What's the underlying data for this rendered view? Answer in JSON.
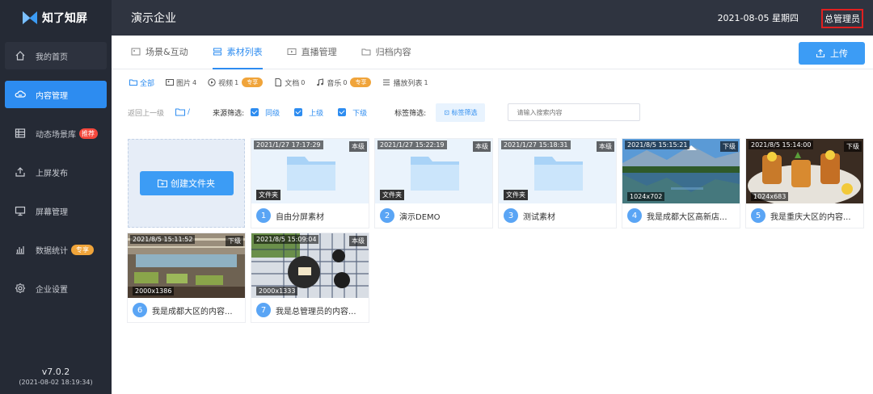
{
  "app": {
    "name": "知了知屏",
    "version": "v7.0.2",
    "build_date": "(2021-08-02 18:19:34)"
  },
  "topbar": {
    "company": "演示企业",
    "datetime": "2021-08-05 星期四",
    "role": "总管理员"
  },
  "sidebar": {
    "items": [
      {
        "label": "我的首页",
        "icon": "home-icon"
      },
      {
        "label": "内容管理",
        "icon": "cloud-icon"
      },
      {
        "label": "动态场景库",
        "icon": "grid-table-icon",
        "badge": "推荐"
      },
      {
        "label": "上屏发布",
        "icon": "publish-icon"
      },
      {
        "label": "屏幕管理",
        "icon": "monitor-icon"
      },
      {
        "label": "数据统计",
        "icon": "stats-icon",
        "badge": "专享"
      },
      {
        "label": "企业设置",
        "icon": "settings-icon"
      }
    ]
  },
  "tabs": [
    {
      "label": "场景&互动",
      "icon": "scene-icon"
    },
    {
      "label": "素材列表",
      "icon": "stack-icon"
    },
    {
      "label": "直播管理",
      "icon": "live-icon"
    },
    {
      "label": "归档内容",
      "icon": "folder-icon"
    }
  ],
  "upload_label": "上传",
  "filters": [
    {
      "label": "全部",
      "count": ""
    },
    {
      "label": "图片",
      "count": "4"
    },
    {
      "label": "视频",
      "count": "1",
      "pro": "专享"
    },
    {
      "label": "文档",
      "count": "0"
    },
    {
      "label": "音乐",
      "count": "0",
      "pro": "专享"
    },
    {
      "label": "播放列表",
      "count": "1"
    }
  ],
  "toolbar": {
    "back": "返回上一级",
    "path": "/",
    "source_label": "来源筛选:",
    "sources": [
      "同级",
      "上级",
      "下级"
    ],
    "tag_label": "标签筛选:",
    "tag_button": "标签筛选",
    "search_placeholder": "请输入搜索内容"
  },
  "create_folder_label": "创建文件夹",
  "items": [
    {
      "num": "1",
      "name": "自由分屏素材",
      "time": "2021/1/27 17:17:29",
      "level": "本级",
      "type": "文件夹"
    },
    {
      "num": "2",
      "name": "演示DEMO",
      "time": "2021/1/27 15:22:19",
      "level": "本级",
      "type": "文件夹"
    },
    {
      "num": "3",
      "name": "测试素材",
      "time": "2021/1/27 15:18:31",
      "level": "本级",
      "type": "文件夹"
    },
    {
      "num": "4",
      "name": "我是成都大区高新店...",
      "time": "2021/8/5 15:15:21",
      "level": "下级",
      "size": "1024x702"
    },
    {
      "num": "5",
      "name": "我是重庆大区的内容...",
      "time": "2021/8/5 15:14:00",
      "level": "下级",
      "size": "1024x683"
    },
    {
      "num": "6",
      "name": "我是成都大区的内容...",
      "time": "2021/8/5 15:11:52",
      "level": "下级",
      "size": "2000x1386"
    },
    {
      "num": "7",
      "name": "我是总管理员的内容...",
      "time": "2021/8/5 15:09:04",
      "level": "本级",
      "size": "2000x1333"
    }
  ]
}
